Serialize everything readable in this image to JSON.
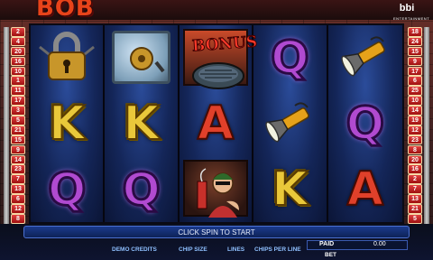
{
  "header": {
    "logo_text": "BOB",
    "brand_logo": "bbi",
    "brand_sub": "ENTERTAINMENT"
  },
  "paylines_left": [
    "2",
    "4",
    "20",
    "16",
    "10",
    "1",
    "11",
    "17",
    "3",
    "5",
    "21",
    "15",
    "9",
    "14",
    "23",
    "7",
    "13",
    "6",
    "12",
    "8"
  ],
  "paylines_right": [
    "18",
    "24",
    "15",
    "9",
    "17",
    "6",
    "25",
    "10",
    "14",
    "19",
    "12",
    "23",
    "8",
    "20",
    "16",
    "2",
    "7",
    "13",
    "21",
    "5"
  ],
  "reels": [
    [
      {
        "kind": "padlock",
        "icon": "padlock-icon"
      },
      {
        "kind": "letter",
        "value": "K",
        "color": "#e9c83a"
      },
      {
        "kind": "letter",
        "value": "Q",
        "color": "#b04ad0"
      }
    ],
    [
      {
        "kind": "safe",
        "icon": "safe-icon"
      },
      {
        "kind": "letter",
        "value": "K",
        "color": "#e9c83a"
      },
      {
        "kind": "letter",
        "value": "Q",
        "color": "#b04ad0"
      }
    ],
    [
      {
        "kind": "bonus",
        "label": "BONUS",
        "icon": "manhole-bonus-icon"
      },
      {
        "kind": "letter",
        "value": "A",
        "color": "#e0402a"
      },
      {
        "kind": "robber",
        "icon": "robber-dynamite-icon"
      }
    ],
    [
      {
        "kind": "letter",
        "value": "Q",
        "color": "#b04ad0"
      },
      {
        "kind": "flashlight",
        "icon": "flashlight-icon"
      },
      {
        "kind": "letter",
        "value": "K",
        "color": "#e9c83a"
      }
    ],
    [
      {
        "kind": "flashlight",
        "icon": "flashlight-icon"
      },
      {
        "kind": "letter",
        "value": "Q",
        "color": "#b04ad0"
      },
      {
        "kind": "letter",
        "value": "A",
        "color": "#e0402a"
      }
    ]
  ],
  "status_message": "CLICK SPIN TO START",
  "controls": {
    "demo_credits": "DEMO CREDITS",
    "chip_size": "CHIP SIZE",
    "lines": "LINES",
    "chips_per_line": "CHIPS PER LINE",
    "paid_label": "PAID",
    "paid_value": "0.00",
    "bet_label": "BET"
  }
}
